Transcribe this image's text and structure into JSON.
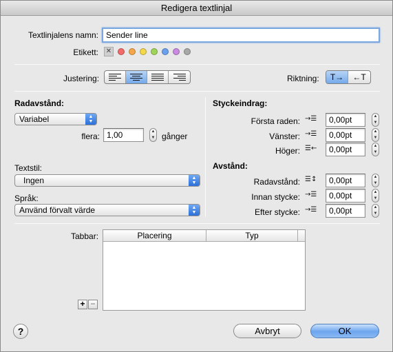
{
  "window": {
    "title": "Redigera textlinjal"
  },
  "name_field": {
    "label": "Textlinjalens namn:",
    "value": "Sender line"
  },
  "label_row": {
    "label": "Etikett:",
    "colors": [
      "#f36a6a",
      "#f5a64a",
      "#f2d84a",
      "#9fd45a",
      "#6aa0ee",
      "#c98ae0",
      "#a8a8a8"
    ]
  },
  "alignment": {
    "label": "Justering:",
    "options": [
      "left",
      "center",
      "justify",
      "right"
    ],
    "selected": "center"
  },
  "direction": {
    "label": "Riktning:",
    "options": [
      "T→",
      "←T"
    ],
    "selected": "T→"
  },
  "line_spacing": {
    "header": "Radavstånd:",
    "mode": "Variabel",
    "multiple_label": "flera:",
    "multiple_value": "1,00",
    "unit": "gånger"
  },
  "text_style": {
    "label": "Textstil:",
    "value": "Ingen"
  },
  "language": {
    "label": "Språk:",
    "value": "Använd förvalt värde"
  },
  "indent": {
    "header": "Styckeindrag:",
    "rows": [
      {
        "label": "Första raden:",
        "value": "0,00pt"
      },
      {
        "label": "Vänster:",
        "value": "0,00pt"
      },
      {
        "label": "Höger:",
        "value": "0,00pt"
      }
    ]
  },
  "spacing": {
    "header": "Avstånd:",
    "rows": [
      {
        "label": "Radavstånd:",
        "value": "0,00pt"
      },
      {
        "label": "Innan stycke:",
        "value": "0,00pt"
      },
      {
        "label": "Efter stycke:",
        "value": "0,00pt"
      }
    ]
  },
  "tabs": {
    "label": "Tabbar:",
    "columns": [
      "Placering",
      "Typ"
    ],
    "add": "+",
    "remove": "−"
  },
  "buttons": {
    "help": "?",
    "cancel": "Avbryt",
    "ok": "OK"
  }
}
